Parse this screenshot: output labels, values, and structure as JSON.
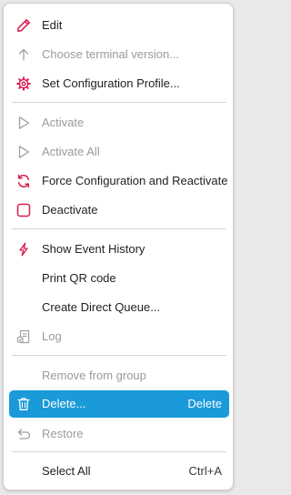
{
  "menu": {
    "edit": {
      "label": "Edit",
      "icon": "pencil-icon",
      "color": "#d81b4c"
    },
    "choose_terminal": {
      "label": "Choose terminal version...",
      "icon": "arrow-up-icon"
    },
    "set_config_profile": {
      "label": "Set Configuration Profile...",
      "icon": "gear-icon",
      "color": "#d81b4c"
    },
    "activate": {
      "label": "Activate",
      "icon": "play-icon"
    },
    "activate_all": {
      "label": "Activate All",
      "icon": "play-icon"
    },
    "force_config": {
      "label": "Force Configuration and Reactivate",
      "icon": "refresh-icon",
      "color": "#d81b4c"
    },
    "deactivate": {
      "label": "Deactivate",
      "icon": "stop-icon",
      "color": "#d81b4c"
    },
    "show_event_history": {
      "label": "Show Event History",
      "icon": "lightning-icon",
      "color": "#d81b4c"
    },
    "print_qr": {
      "label": "Print QR code"
    },
    "create_direct_queue": {
      "label": "Create Direct Queue..."
    },
    "log": {
      "label": "Log",
      "icon": "log-document-icon"
    },
    "remove_from_group": {
      "label": "Remove from group"
    },
    "delete": {
      "label": "Delete...",
      "shortcut": "Delete",
      "icon": "trash-icon",
      "highlight_color": "#1a9ad9"
    },
    "restore": {
      "label": "Restore",
      "icon": "undo-icon"
    },
    "select_all": {
      "label": "Select All",
      "shortcut": "Ctrl+A"
    }
  }
}
